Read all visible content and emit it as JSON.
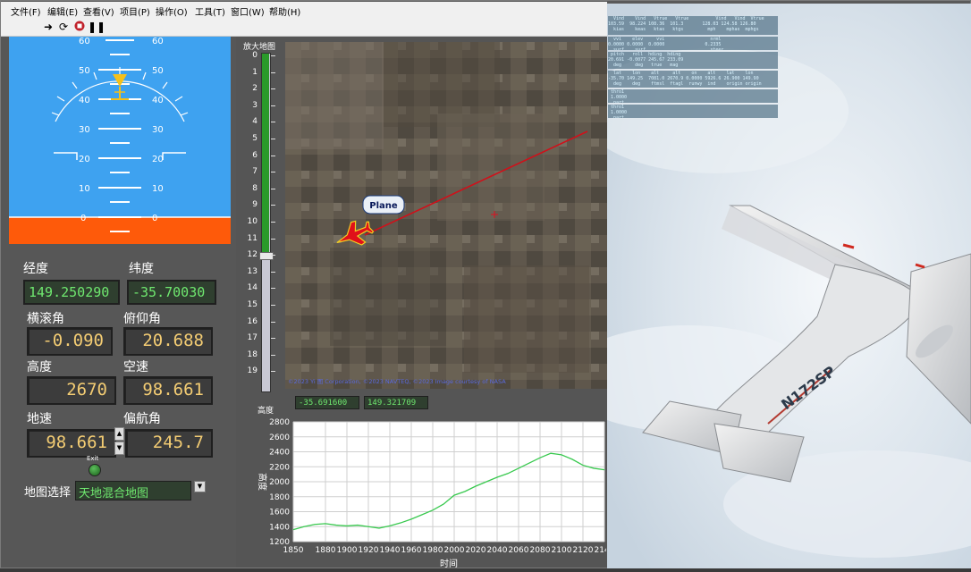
{
  "menu": [
    "文件(F)",
    "编辑(E)",
    "查看(V)",
    "项目(P)",
    "操作(O)",
    "工具(T)",
    "窗口(W)",
    "帮助(H)"
  ],
  "toolbar_icons": [
    "run-arrow-icon",
    "continuous-run-icon",
    "abort-stop-icon",
    "pause-icon"
  ],
  "attitude": {
    "pitch_ticks": [
      "60",
      "50",
      "40",
      "30",
      "20",
      "10",
      "0"
    ],
    "sky_color": "#3ea2f0",
    "ground_color": "#fe5a0a"
  },
  "fields": {
    "longitude_label": "经度",
    "longitude": "149.250290",
    "latitude_label": "纬度",
    "latitude": "-35.70030",
    "roll_label": "横滚角",
    "roll": "-0.090",
    "pitch_label": "俯仰角",
    "pitch": "20.688",
    "altitude_label": "高度",
    "altitude": "2670",
    "airspeed_label": "空速",
    "airspeed": "98.661",
    "groundspeed_label": "地速",
    "groundspeed": "98.661",
    "heading_label": "偏航角",
    "heading": "245.7",
    "exit_label": "Exit",
    "map_select_label": "地图选择",
    "map_select_value": "天地混合地图"
  },
  "map": {
    "zoom_label": "放大地图",
    "zoom_ticks": [
      "0",
      "1",
      "2",
      "3",
      "4",
      "5",
      "6",
      "7",
      "8",
      "9",
      "10",
      "11",
      "12",
      "13",
      "14",
      "15",
      "16",
      "17",
      "18",
      "19"
    ],
    "zoom_value": 12,
    "plane_label": "Plane",
    "copyright": "©2023 Yi 图 Corporation, ©2023 NAVTEQ, ©2023 Image courtesy of NASA",
    "coord_label": "高度",
    "lat_readout": "-35.691600",
    "lon_readout": "149.321709"
  },
  "chart_data": {
    "type": "line",
    "xlabel": "时间",
    "ylabel": "高度",
    "xlim": [
      1850,
      2140
    ],
    "ylim": [
      1200,
      2800
    ],
    "x_ticks": [
      "1850",
      "1880",
      "1900",
      "1920",
      "1940",
      "1960",
      "1980",
      "2000",
      "2020",
      "2040",
      "2060",
      "2080",
      "2100",
      "2120",
      "2140"
    ],
    "y_ticks": [
      "1200",
      "1400",
      "1600",
      "1800",
      "2000",
      "2200",
      "2400",
      "2600",
      "2800"
    ],
    "series": [
      {
        "x": [
          1850,
          1860,
          1870,
          1880,
          1890,
          1900,
          1910,
          1920,
          1930,
          1940,
          1950,
          1960,
          1970,
          1980,
          1990,
          2000,
          2010,
          2020,
          2030,
          2040,
          2050,
          2060,
          2070,
          2080,
          2090,
          2100,
          2110,
          2120,
          2130,
          2140
        ],
        "y": [
          1360,
          1400,
          1430,
          1440,
          1420,
          1410,
          1420,
          1400,
          1380,
          1410,
          1450,
          1500,
          1560,
          1620,
          1700,
          1820,
          1870,
          1940,
          2000,
          2060,
          2110,
          2180,
          2250,
          2320,
          2380,
          2360,
          2300,
          2220,
          2180,
          2160
        ],
        "color": "#39c94f"
      }
    ]
  },
  "sim": {
    "tail_number": "N172SP",
    "data_rows": [
      "  Vind    Vind   Vtrue   Vtrue          Vind   Vind  Vtrue\n103.59  98.224 108.36  101.3       128.03 124.58 126.80\n  kias    keas   ktas   ktgs         mph    mphas  mphgs",
      "  vvi    elev     vvi                 nrml\n0.0000 0.0000  0.0000               0.2335\n  surf    surf                        steer",
      " pitch   roll  hding  hding\n20.691 -0.0077 245.67 233.09\n  deg     deg   true   mag",
      "  lat    lon    alt     alt    on    alt    lat    lon\n-35.70 149.25  7081.0 2670.9 0.0000 5926.6 26.900 149.90\n  deg    deg    ftmsl  ftagl  runwy  ind    origin origin",
      " thro1\n 1.0000\n  part",
      " thro1\n 1.0000\n  part"
    ]
  }
}
